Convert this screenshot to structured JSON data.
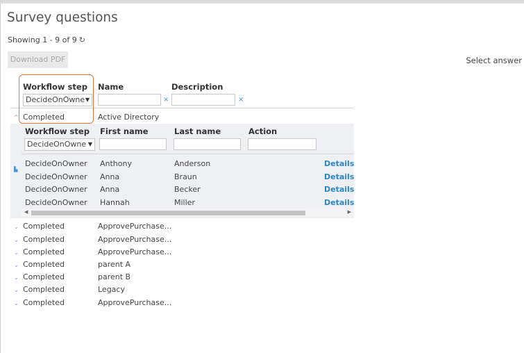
{
  "page": {
    "title": "Survey questions",
    "showing": "Showing 1 - 9 of 9",
    "refresh_icon": "refresh-icon ↻"
  },
  "toolbar": {
    "download_pdf": "Download PDF"
  },
  "right_panel": {
    "select_answer": "Select answer"
  },
  "table": {
    "headers": {
      "workflow_step": "Workflow step",
      "name": "Name",
      "description": "Description"
    },
    "filters": {
      "workflow_step_value": "DecideOnOwne",
      "name_value": "",
      "description_value": ""
    },
    "rows": [
      {
        "step": "Completed",
        "name": "Active Directory",
        "expanded": true
      },
      {
        "step": "Completed",
        "name": "ApprovePurchase..."
      },
      {
        "step": "Completed",
        "name": "ApprovePurchase..."
      },
      {
        "step": "Completed",
        "name": "ApprovePurchase..."
      },
      {
        "step": "Completed",
        "name": "parent A"
      },
      {
        "step": "Completed",
        "name": "parent B"
      },
      {
        "step": "Completed",
        "name": "Legacy"
      },
      {
        "step": "Completed",
        "name": "ApprovePurchase..."
      }
    ]
  },
  "subtable": {
    "headers": {
      "workflow_step": "Workflow step",
      "first_name": "First name",
      "last_name": "Last name",
      "action": "Action"
    },
    "filters": {
      "workflow_step_value": "DecideOnOwne",
      "first_name_value": "",
      "last_name_value": "",
      "action_value": ""
    },
    "rows": [
      {
        "step": "DecideOnOwner",
        "first": "Anthony",
        "last": "Anderson",
        "link": "Details"
      },
      {
        "step": "DecideOnOwner",
        "first": "Anna",
        "last": "Braun",
        "link": "Details"
      },
      {
        "step": "DecideOnOwner",
        "first": "Anna",
        "last": "Becker",
        "link": "Details"
      },
      {
        "step": "DecideOnOwner",
        "first": "Hannah",
        "last": "Miller",
        "link": "Details"
      }
    ]
  },
  "colors": {
    "accent": "#e8703d",
    "link": "#2a86c8",
    "subpanel": "#eef0f3"
  }
}
